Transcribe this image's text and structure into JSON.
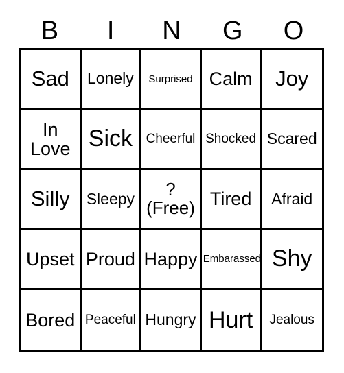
{
  "card": {
    "type": "bingo-card",
    "theme": "Emotions",
    "grid_size": "5x5",
    "header_letters": [
      "B",
      "I",
      "N",
      "G",
      "O"
    ],
    "free_space_position": "center",
    "colors": {
      "background": "#ffffff",
      "border": "#000000",
      "text": "#000000"
    },
    "rows": [
      [
        {
          "label": "Sad",
          "size": "lg",
          "free": false
        },
        {
          "label": "Lonely",
          "size": "sm",
          "free": false
        },
        {
          "label": "Surprised",
          "size": "xxs",
          "free": false
        },
        {
          "label": "Calm",
          "size": "md",
          "free": false
        },
        {
          "label": "Joy",
          "size": "lg",
          "free": false
        }
      ],
      [
        {
          "label": "In\nLove",
          "size": "md",
          "free": false
        },
        {
          "label": "Sick",
          "size": "xl",
          "free": false
        },
        {
          "label": "Cheerful",
          "size": "xs",
          "free": false
        },
        {
          "label": "Shocked",
          "size": "xs",
          "free": false
        },
        {
          "label": "Scared",
          "size": "sm",
          "free": false
        }
      ],
      [
        {
          "label": "Silly",
          "size": "lg",
          "free": false
        },
        {
          "label": "Sleepy",
          "size": "sm",
          "free": false
        },
        {
          "label": "?\n(Free)",
          "size": "free",
          "free": true
        },
        {
          "label": "Tired",
          "size": "md",
          "free": false
        },
        {
          "label": "Afraid",
          "size": "sm",
          "free": false
        }
      ],
      [
        {
          "label": "Upset",
          "size": "md",
          "free": false
        },
        {
          "label": "Proud",
          "size": "md",
          "free": false
        },
        {
          "label": "Happy",
          "size": "md",
          "free": false
        },
        {
          "label": "Embarassed",
          "size": "xxs",
          "free": false
        },
        {
          "label": "Shy",
          "size": "xl",
          "free": false
        }
      ],
      [
        {
          "label": "Bored",
          "size": "md",
          "free": false
        },
        {
          "label": "Peaceful",
          "size": "xs",
          "free": false
        },
        {
          "label": "Hungry",
          "size": "sm",
          "free": false
        },
        {
          "label": "Hurt",
          "size": "xl",
          "free": false
        },
        {
          "label": "Jealous",
          "size": "xs",
          "free": false
        }
      ]
    ]
  }
}
